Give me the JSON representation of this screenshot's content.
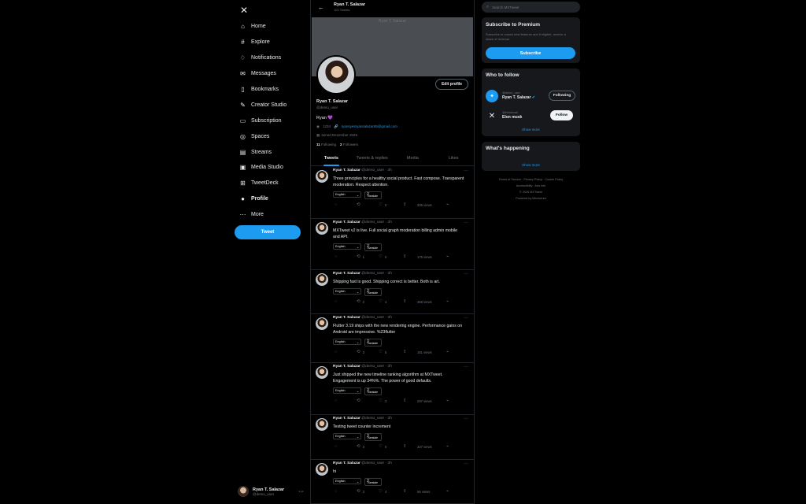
{
  "sidebar": {
    "logo_icon": "x-logo-icon",
    "items": [
      {
        "label": "Home",
        "icon": "home-icon"
      },
      {
        "label": "Explore",
        "icon": "hashtag-icon"
      },
      {
        "label": "Notifications",
        "icon": "bell-icon"
      },
      {
        "label": "Messages",
        "icon": "mail-icon"
      },
      {
        "label": "Bookmarks",
        "icon": "bookmark-icon"
      },
      {
        "label": "Creator Studio",
        "icon": "pen-icon"
      },
      {
        "label": "Subscription",
        "icon": "card-icon"
      },
      {
        "label": "Spaces",
        "icon": "mic-icon"
      },
      {
        "label": "Streams",
        "icon": "stream-icon"
      },
      {
        "label": "Media Studio",
        "icon": "media-icon"
      },
      {
        "label": "TweetDeck",
        "icon": "grid-icon"
      },
      {
        "label": "Profile",
        "icon": "person-icon"
      },
      {
        "label": "More",
        "icon": "more-icon"
      }
    ],
    "tweet_button": "Tweet",
    "account": {
      "name": "Ryan T. Salazar",
      "handle": "@demo_user",
      "more": "···"
    }
  },
  "profile": {
    "header_title": "Ryan T. Salazar",
    "header_subtitle": "102 Tweets",
    "banner_text": "Ryan T. Salazar",
    "edit_button": "Edit profile",
    "name": "Ryan T. Salazar",
    "handle": "@demo_user",
    "bio": "Ryan",
    "bio_emoji": "💜",
    "location": "1234",
    "email": "ryansyesryansalazar65@gmail.com",
    "joined": "Joined December 2025",
    "following_count": "11",
    "following_label": "Following",
    "followers_count": "2",
    "followers_label": "Followers",
    "tabs": [
      "Tweets",
      "Tweets & replies",
      "Media",
      "Likes"
    ]
  },
  "tweets": [
    {
      "name": "Ryan T. Salazar",
      "meta": "@demo_user · 3h",
      "text": "Three principles for a healthy social product. Fast compose. Transparent moderation. Respect attention.",
      "language": "English",
      "translate": "Translate",
      "replies": "",
      "retweets": "",
      "likes": "0",
      "views": "305 views"
    },
    {
      "name": "Ryan T. Salazar",
      "meta": "@demo_user · 3h",
      "text": "MXTweet v2 is live. Full social graph moderation billing admin mobile and API.",
      "language": "English",
      "translate": "Translate",
      "replies": "",
      "retweets": "1",
      "likes": "0",
      "views": "175 views"
    },
    {
      "name": "Ryan T. Salazar",
      "meta": "@demo_user · 3h",
      "text": "Shipping fast is good. Shipping correct is better. Both is art.",
      "language": "English",
      "translate": "Translate",
      "replies": "",
      "retweets": "2",
      "likes": "4",
      "views": "368 views"
    },
    {
      "name": "Ryan T. Salazar",
      "meta": "@demo_user · 3h",
      "text": "Flutter 3.19 ships with the new rendering engine. Performance gains on Android are impressive. %23flutter",
      "language": "English",
      "translate": "Translate",
      "replies": "",
      "retweets": "3",
      "likes": "5",
      "views": "161 views"
    },
    {
      "name": "Ryan T. Salazar",
      "meta": "@demo_user · 3h",
      "text": "Just shipped the new timeline ranking algorithm at MXTweet. Engagement is up 34%%. The power of good defaults.",
      "language": "English",
      "translate": "Translate",
      "replies": "",
      "retweets": "",
      "likes": "3",
      "views": "297 views"
    },
    {
      "name": "Ryan T. Salazar",
      "meta": "@demo_user · 3h",
      "text": "Testing tweet counter increment",
      "language": "English",
      "translate": "Translate",
      "replies": "",
      "retweets": "3",
      "likes": "0",
      "views": "327 views"
    },
    {
      "name": "Ryan T. Salazar",
      "meta": "@demo_user · 3h",
      "text": "hi",
      "language": "English",
      "translate": "Translate",
      "replies": "",
      "retweets": "3",
      "likes": "4",
      "views": "56 views"
    }
  ],
  "right": {
    "search_placeholder": "Search MXTweet",
    "premium_title": "Subscribe to Premium",
    "premium_text": "Subscribe to unlock new features and if eligible, receive a share of revenue.",
    "subscribe_button": "Subscribe",
    "who_to_follow": "Who to follow",
    "suggestions": [
      {
        "sub": "@demo_user",
        "name": "Ryan T. Salazar",
        "button": "Following"
      },
      {
        "sub": "@elonmusk",
        "name": "Elon musk",
        "button": "Follow"
      }
    ],
    "show_more": "Show more",
    "whats_happening": "What's happening",
    "show_more_2": "Show more",
    "footer_line1": "Terms of Service  ·  Privacy Policy  ·  Cookie Policy",
    "footer_line2": "Accessibility  ·  Ads info",
    "footer_line3": "© 2026 MXTweet",
    "footer_line4": "Powered by Mindverse"
  },
  "colors": {
    "accent": "#1d9bf0",
    "background": "#000000",
    "card": "#16181c",
    "bio_heart": "#a855f7"
  }
}
